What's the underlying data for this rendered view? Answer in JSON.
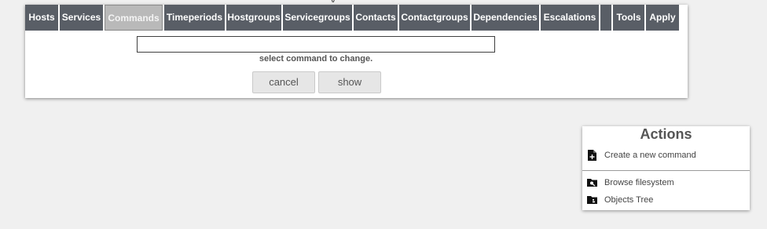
{
  "nav": {
    "tabs": [
      {
        "label": "Hosts",
        "active": false
      },
      {
        "label": "Services",
        "active": false
      },
      {
        "label": "Commands",
        "active": true
      },
      {
        "label": "Timeperiods",
        "active": false
      },
      {
        "label": "Hostgroups",
        "active": false
      },
      {
        "label": "Servicegroups",
        "active": false
      },
      {
        "label": "Contacts",
        "active": false
      },
      {
        "label": "Contactgroups",
        "active": false
      },
      {
        "label": "Dependencies",
        "active": false
      },
      {
        "label": "Escalations",
        "active": false
      },
      {
        "label": "",
        "active": false
      },
      {
        "label": "Tools",
        "active": false
      },
      {
        "label": "Apply",
        "active": false
      }
    ]
  },
  "form": {
    "command_value": "",
    "hint": "select command to change.",
    "cancel_label": "cancel",
    "show_label": "show"
  },
  "actions": {
    "title": "Actions",
    "items": [
      {
        "label": "Create a new command",
        "icon": "file-plus-icon"
      },
      {
        "label": "Browse filesystem",
        "icon": "folder-search-icon"
      },
      {
        "label": "Objects Tree",
        "icon": "folder-tree-icon"
      }
    ]
  },
  "colors": {
    "tab_bg": "#595e66",
    "tab_active_bg": "#b9b9b9",
    "page_bg": "#f0f0f0"
  }
}
